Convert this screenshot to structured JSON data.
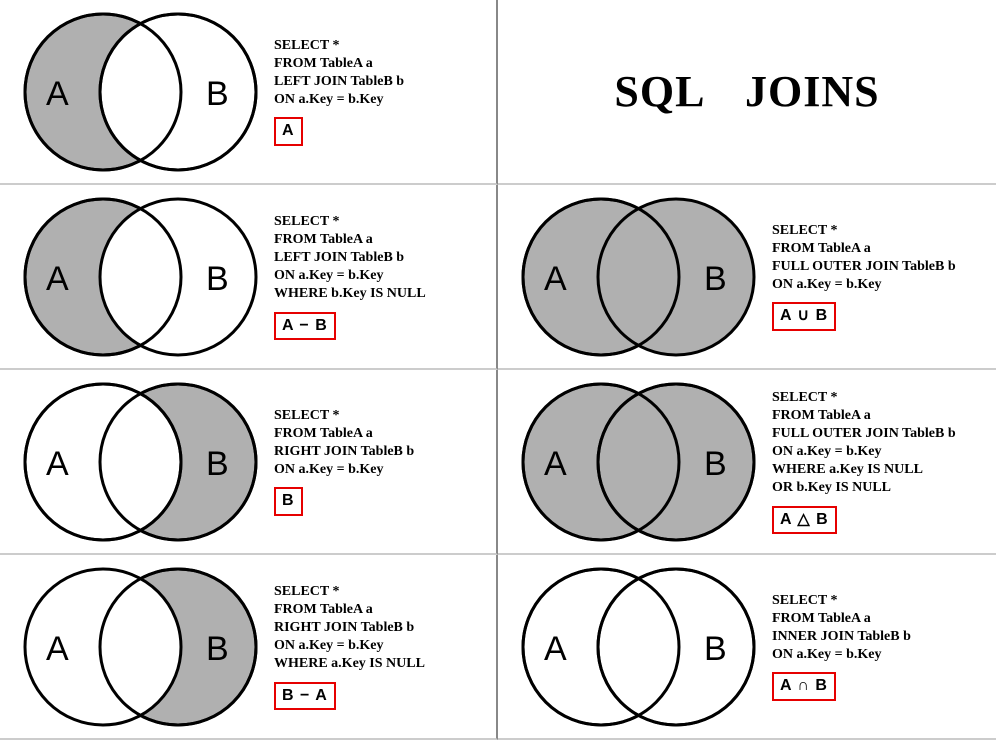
{
  "title": "SQL JOINS",
  "labels": {
    "A": "A",
    "B": "B"
  },
  "joins": {
    "left": {
      "sql": [
        "SELECT *",
        "FROM TableA a",
        "LEFT JOIN TableB b",
        "ON a.Key = b.Key"
      ],
      "badge": "A"
    },
    "left_excl": {
      "sql": [
        "SELECT *",
        "FROM TableA a",
        "LEFT JOIN TableB b",
        "ON a.Key = b.Key",
        "WHERE b.Key IS NULL"
      ],
      "badge": "A − B"
    },
    "right": {
      "sql": [
        "SELECT *",
        "FROM TableA a",
        "RIGHT JOIN TableB b",
        "ON a.Key = b.Key"
      ],
      "badge": "B"
    },
    "right_excl": {
      "sql": [
        "SELECT *",
        "FROM TableA a",
        "RIGHT JOIN TableB b",
        "ON a.Key = b.Key",
        "WHERE a.Key IS NULL"
      ],
      "badge": "B − A"
    },
    "full": {
      "sql": [
        "SELECT *",
        "FROM TableA a",
        "FULL OUTER JOIN TableB b",
        "ON a.Key = b.Key"
      ],
      "badge": "A ∪ B"
    },
    "full_excl": {
      "sql": [
        "SELECT *",
        "FROM TableA a",
        "FULL OUTER JOIN TableB b",
        "ON a.Key = b.Key",
        "WHERE a.Key IS NULL",
        "OR b.Key IS NULL"
      ],
      "badge": "A △ B"
    },
    "inner": {
      "sql": [
        "SELECT *",
        "FROM TableA a",
        "INNER JOIN TableB b",
        "ON a.Key = b.Key"
      ],
      "badge": "A ∩ B"
    }
  }
}
